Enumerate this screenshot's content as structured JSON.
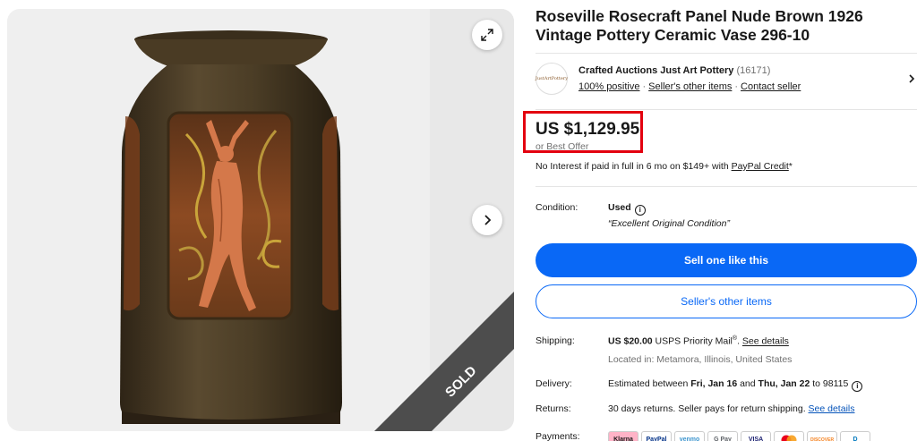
{
  "listing": {
    "title": "Roseville Rosecraft Panel Nude Brown 1926 Vintage Pottery Ceramic Vase 296-10",
    "sold_badge": "SOLD"
  },
  "seller": {
    "logo_text": "JustArtPottery",
    "name": "Crafted Auctions Just Art Pottery",
    "feedback_count": "(16171)",
    "positive": "100% positive",
    "other_items": "Seller's other items",
    "contact": "Contact seller"
  },
  "price": {
    "amount": "US $1,129.95",
    "best_offer": "or Best Offer",
    "financing_prefix": "No Interest if paid in full in 6 mo on $149+ with ",
    "financing_link": "PayPal Credit",
    "financing_suffix": "*"
  },
  "condition": {
    "label": "Condition:",
    "value": "Used",
    "quote": "“Excellent Original Condition”"
  },
  "actions": {
    "sell_one": "Sell one like this",
    "seller_items": "Seller's other items"
  },
  "shipping": {
    "label": "Shipping:",
    "cost": "US $20.00",
    "method": " USPS Priority Mail",
    "method_sup": "®",
    "details_link": "See details",
    "location": "Located in: Metamora, Illinois, United States"
  },
  "delivery": {
    "label": "Delivery:",
    "prefix": "Estimated between ",
    "start": "Fri, Jan 16",
    "mid": " and ",
    "end": "Thu, Jan 22",
    "suffix": " to 98115"
  },
  "returns": {
    "label": "Returns:",
    "text": "30 days returns. Seller pays for return shipping. ",
    "link": "See details"
  },
  "payments": {
    "label": "Payments:",
    "methods": [
      "Klarna",
      "PayPal",
      "venmo",
      "G Pay",
      "VISA",
      "MC",
      "DISCOVER",
      "D"
    ]
  },
  "colors": {
    "accent_blue": "#0968f6",
    "price_highlight": "#e3000f",
    "vase_brown": "#4a3a24",
    "figure_orange": "#c8663a"
  }
}
